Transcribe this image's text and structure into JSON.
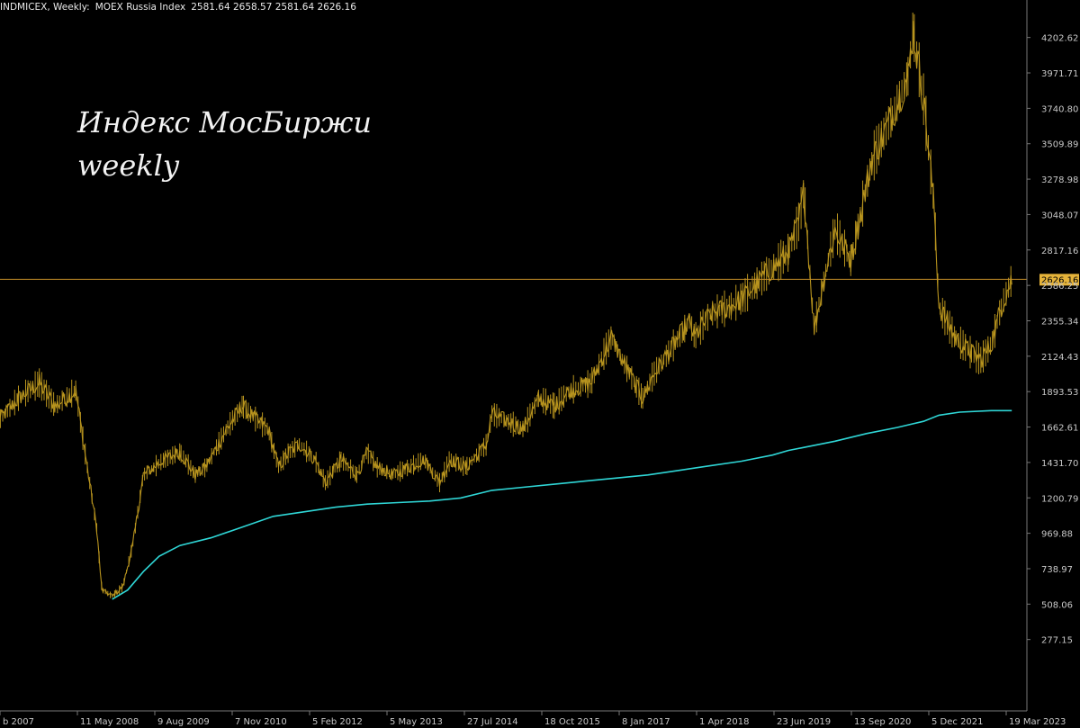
{
  "header": {
    "symbol_tf": "INDMICEX, Weekly:",
    "name": "MOEX Russia Index",
    "ohlc": "2581.64 2658.57 2581.64 2626.16"
  },
  "overlay": {
    "line1": "Индекс МосБиржи",
    "line2": "weekly"
  },
  "colors": {
    "background": "#000000",
    "price_bars": "#b8941e",
    "moving_average": "#2fd6d6",
    "current_price_line": "#c8902a",
    "current_price_tag_bg": "#e5b33a",
    "axis_text": "#c8c8c8",
    "axis_line": "#777777"
  },
  "chart_data": {
    "type": "line",
    "title": "",
    "xlabel": "",
    "ylabel": "",
    "y_axis_side": "right",
    "grid": false,
    "ylim": [
      46.4,
      4318
    ],
    "y_ticks": [
      277.15,
      508.06,
      738.97,
      969.88,
      1200.79,
      1431.7,
      1662.61,
      1893.53,
      2124.43,
      2355.34,
      2586.25,
      2817.16,
      3048.07,
      3278.98,
      3509.89,
      3740.8,
      3971.71,
      4202.62
    ],
    "y_tick_labels": [
      "277.15",
      "508.06",
      "738.97",
      "969.88",
      "1200.79",
      "1431.70",
      "1662.61",
      "1893.53",
      "2124.43",
      "2355.34",
      "2586.25",
      "2817.16",
      "3048.07",
      "3278.98",
      "3509.89",
      "3740.80",
      "3971.71",
      "4202.62"
    ],
    "x_tick_labels": [
      "b 2007",
      "11 May 2008",
      "9 Aug 2009",
      "7 Nov 2010",
      "5 Feb 2012",
      "5 May 2013",
      "27 Jul 2014",
      "18 Oct 2015",
      "8 Jan 2017",
      "1 Apr 2018",
      "23 Jun 2019",
      "13 Sep 2020",
      "5 Dec 2021",
      "19 Mar 2023"
    ],
    "current_price": 2626.16,
    "current_price_label": "2626.16",
    "series": [
      {
        "role": "price",
        "x": [
          "2007-02",
          "2007-06",
          "2007-10",
          "2008-01",
          "2008-05",
          "2008-07",
          "2008-09",
          "2008-10",
          "2008-12",
          "2009-02",
          "2009-04",
          "2009-06",
          "2009-08",
          "2009-10",
          "2010-01",
          "2010-04",
          "2010-06",
          "2010-10",
          "2011-01",
          "2011-04",
          "2011-06",
          "2011-08",
          "2011-10",
          "2011-12",
          "2012-03",
          "2012-05",
          "2012-08",
          "2012-11",
          "2013-01",
          "2013-03",
          "2013-06",
          "2013-09",
          "2013-12",
          "2014-03",
          "2014-05",
          "2014-08",
          "2014-12",
          "2015-01",
          "2015-04",
          "2015-07",
          "2015-10",
          "2016-01",
          "2016-04",
          "2016-08",
          "2016-12",
          "2017-02",
          "2017-06",
          "2017-08",
          "2017-12",
          "2018-03",
          "2018-04",
          "2018-07",
          "2018-11",
          "2019-01",
          "2019-04",
          "2019-07",
          "2019-10",
          "2019-12",
          "2020-01",
          "2020-03",
          "2020-05",
          "2020-07",
          "2020-10",
          "2021-02",
          "2021-06",
          "2021-09",
          "2021-10",
          "2021-12",
          "2022-02",
          "2022-03",
          "2022-06",
          "2022-09",
          "2022-11",
          "2023-01",
          "2023-03",
          "2023-05"
        ],
        "values": [
          1700,
          1850,
          1950,
          1800,
          1900,
          1450,
          1000,
          600,
          560,
          620,
          900,
          1350,
          1400,
          1450,
          1500,
          1350,
          1400,
          1650,
          1800,
          1700,
          1650,
          1400,
          1500,
          1550,
          1450,
          1300,
          1450,
          1350,
          1500,
          1400,
          1350,
          1400,
          1450,
          1300,
          1450,
          1400,
          1550,
          1750,
          1700,
          1650,
          1850,
          1800,
          1900,
          1950,
          2250,
          2100,
          1850,
          2000,
          2200,
          2350,
          2250,
          2400,
          2450,
          2500,
          2600,
          2700,
          2800,
          3000,
          3200,
          2300,
          2650,
          2950,
          2750,
          3400,
          3700,
          3950,
          4250,
          3800,
          3100,
          2450,
          2250,
          2150,
          2100,
          2200,
          2450,
          2626.16
        ]
      },
      {
        "role": "moving_average",
        "x": [
          "2008-12",
          "2009-03",
          "2009-06",
          "2009-09",
          "2010-01",
          "2010-07",
          "2011-01",
          "2011-07",
          "2012-01",
          "2012-07",
          "2013-01",
          "2013-07",
          "2014-01",
          "2014-07",
          "2015-01",
          "2015-07",
          "2016-01",
          "2016-07",
          "2017-01",
          "2017-07",
          "2018-01",
          "2018-07",
          "2019-01",
          "2019-07",
          "2019-10",
          "2020-01",
          "2020-07",
          "2021-01",
          "2021-07",
          "2021-12",
          "2022-03",
          "2022-07",
          "2023-01",
          "2023-05"
        ],
        "values": [
          540,
          600,
          720,
          820,
          890,
          940,
          1010,
          1080,
          1110,
          1140,
          1160,
          1170,
          1180,
          1200,
          1250,
          1270,
          1290,
          1310,
          1330,
          1350,
          1380,
          1410,
          1440,
          1480,
          1510,
          1530,
          1570,
          1620,
          1660,
          1700,
          1740,
          1760,
          1770,
          1770
        ]
      }
    ]
  }
}
